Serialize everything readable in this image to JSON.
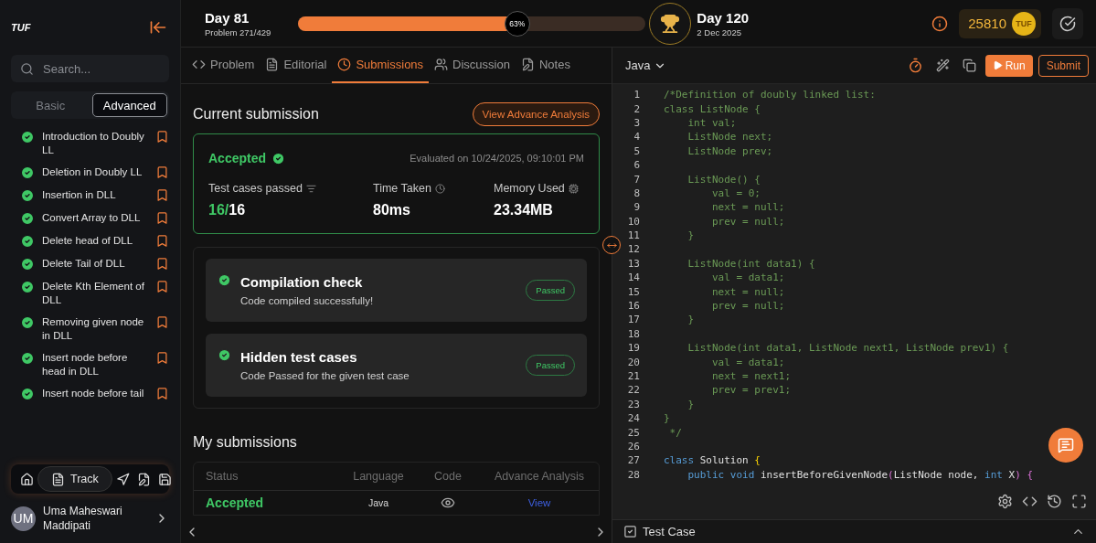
{
  "sidebar": {
    "logo": "TUF",
    "search": {
      "placeholder": "Search..."
    },
    "segments": [
      {
        "label": "Basic",
        "selected": false
      },
      {
        "label": "Advanced",
        "selected": true
      }
    ],
    "items": [
      {
        "title": "Introduction to Doubly LL",
        "solved": true
      },
      {
        "title": "Deletion in Doubly LL",
        "solved": true
      },
      {
        "title": "Insertion in DLL",
        "solved": true
      },
      {
        "title": "Convert Array to DLL",
        "solved": true
      },
      {
        "title": "Delete head of DLL",
        "solved": true
      },
      {
        "title": "Delete Tail of DLL",
        "solved": true
      },
      {
        "title": "Delete Kth Element of DLL",
        "solved": true
      },
      {
        "title": "Removing given node in DLL",
        "solved": true
      },
      {
        "title": "Insert node before head in DLL",
        "solved": true
      },
      {
        "title": "Insert node before tail",
        "solved": true
      }
    ],
    "nav": [
      {
        "kind": "home",
        "selected": false
      },
      {
        "kind": "track",
        "label": "Track",
        "selected": true
      },
      {
        "kind": "send",
        "selected": false
      },
      {
        "kind": "notes",
        "selected": false
      },
      {
        "kind": "save",
        "selected": false
      }
    ],
    "user": {
      "initials": "UM",
      "name": "Uma Maheswari Maddipati"
    }
  },
  "header": {
    "start_day": "Day 81",
    "problem": "Problem 271/429",
    "progress": {
      "level": 0.63,
      "reading": "63%"
    },
    "end_day": "Day 120",
    "end_date": "2 Dec 2025",
    "coins": "25810",
    "coin_label": "TUF"
  },
  "tabs": [
    {
      "kind": "problem",
      "label": "Problem",
      "selected": false
    },
    {
      "kind": "editorial",
      "label": "Editorial",
      "selected": false
    },
    {
      "kind": "submissions",
      "label": "Submissions",
      "selected": true
    },
    {
      "kind": "discussion",
      "label": "Discussion",
      "selected": false
    },
    {
      "kind": "notes",
      "label": "Notes",
      "selected": false
    }
  ],
  "current": {
    "title": "Current submission",
    "analysis_button": "View Advance Analysis",
    "status": "Accepted",
    "evaluated": "Evaluated on 10/24/2025, 09:10:01 PM",
    "stats": [
      {
        "kind": "tests",
        "label": "Test cases passed",
        "passed": "16/",
        "total": "16"
      },
      {
        "kind": "time",
        "label": "Time Taken",
        "value": "80ms"
      },
      {
        "kind": "memory",
        "label": "Memory Used",
        "value": "23.34MB"
      }
    ],
    "checks": [
      {
        "title": "Compilation check",
        "description": "Code compiled successfully!",
        "badge": "Passed",
        "passed": true
      },
      {
        "title": "Hidden test cases",
        "description": "Code Passed for the given test case",
        "badge": "Passed",
        "passed": true
      }
    ]
  },
  "submissions": {
    "title": "My submissions",
    "columns": [
      "Status",
      "Language",
      "Code",
      "Advance Analysis"
    ],
    "rows": [
      {
        "status": "Accepted",
        "language": "Java",
        "link": "View"
      }
    ]
  },
  "editor": {
    "language": "Java",
    "run": "Run",
    "submit": "Submit",
    "lines": [
      {
        "number": "1",
        "tokens": [
          {
            "kind": "comment",
            "text": "/*Definition of doubly linked list:"
          }
        ]
      },
      {
        "number": "2",
        "tokens": [
          {
            "kind": "comment",
            "text": "class ListNode {"
          }
        ]
      },
      {
        "number": "3",
        "tokens": [
          {
            "kind": "comment",
            "text": "    int val;"
          }
        ]
      },
      {
        "number": "4",
        "tokens": [
          {
            "kind": "comment",
            "text": "    ListNode next;"
          }
        ]
      },
      {
        "number": "5",
        "tokens": [
          {
            "kind": "comment",
            "text": "    ListNode prev;"
          }
        ]
      },
      {
        "number": "6"
      },
      {
        "number": "7",
        "tokens": [
          {
            "kind": "comment",
            "text": "    ListNode() {"
          }
        ]
      },
      {
        "number": "8",
        "tokens": [
          {
            "kind": "comment",
            "text": "        val = 0;"
          }
        ]
      },
      {
        "number": "9",
        "tokens": [
          {
            "kind": "comment",
            "text": "        next = null;"
          }
        ]
      },
      {
        "number": "10",
        "tokens": [
          {
            "kind": "comment",
            "text": "        prev = null;"
          }
        ]
      },
      {
        "number": "11",
        "tokens": [
          {
            "kind": "comment",
            "text": "    }"
          }
        ]
      },
      {
        "number": "12"
      },
      {
        "number": "13",
        "tokens": [
          {
            "kind": "comment",
            "text": "    ListNode(int data1) {"
          }
        ]
      },
      {
        "number": "14",
        "tokens": [
          {
            "kind": "comment",
            "text": "        val = data1;"
          }
        ]
      },
      {
        "number": "15",
        "tokens": [
          {
            "kind": "comment",
            "text": "        next = null;"
          }
        ]
      },
      {
        "number": "16",
        "tokens": [
          {
            "kind": "comment",
            "text": "        prev = null;"
          }
        ]
      },
      {
        "number": "17",
        "tokens": [
          {
            "kind": "comment",
            "text": "    }"
          }
        ]
      },
      {
        "number": "18"
      },
      {
        "number": "19",
        "tokens": [
          {
            "kind": "comment",
            "text": "    ListNode(int data1, ListNode next1, ListNode prev1) {"
          }
        ]
      },
      {
        "number": "20",
        "tokens": [
          {
            "kind": "comment",
            "text": "        val = data1;"
          }
        ]
      },
      {
        "number": "21",
        "tokens": [
          {
            "kind": "comment",
            "text": "        next = next1;"
          }
        ]
      },
      {
        "number": "22",
        "tokens": [
          {
            "kind": "comment",
            "text": "        prev = prev1;"
          }
        ]
      },
      {
        "number": "23",
        "tokens": [
          {
            "kind": "comment",
            "text": "    }"
          }
        ]
      },
      {
        "number": "24",
        "tokens": [
          {
            "kind": "comment",
            "text": "}"
          }
        ]
      },
      {
        "number": "25",
        "tokens": [
          {
            "kind": "comment",
            "text": " */"
          }
        ]
      },
      {
        "number": "26"
      },
      {
        "number": "27",
        "tokens": [
          {
            "kind": "keyword",
            "text": "class"
          },
          {
            "kind": "plain",
            "text": " Solution "
          },
          {
            "kind": "bracket",
            "text": "{"
          }
        ]
      },
      {
        "number": "28",
        "tokens": [
          {
            "kind": "keyword",
            "text": "    public void"
          },
          {
            "kind": "plain",
            "text": " insertBeforeGivenNode"
          },
          {
            "kind": "paren",
            "text": "("
          },
          {
            "kind": "plain",
            "text": "ListNode node, "
          },
          {
            "kind": "keyword",
            "text": "int"
          },
          {
            "kind": "plain",
            "text": " X"
          },
          {
            "kind": "paren",
            "text": ") {"
          }
        ]
      }
    ]
  },
  "test_case": {
    "label": "Test Case"
  }
}
